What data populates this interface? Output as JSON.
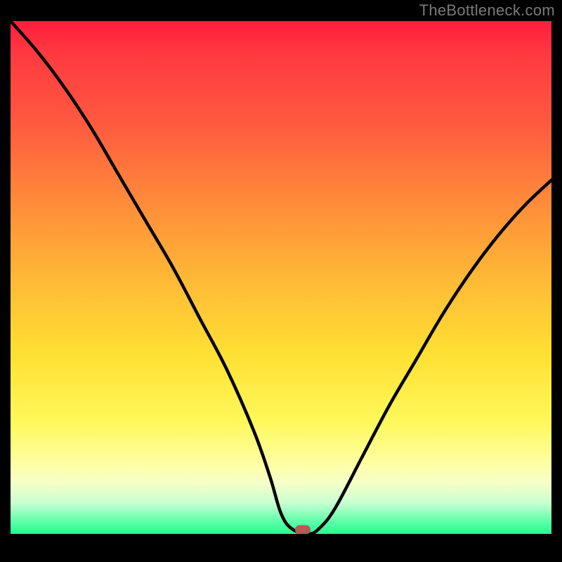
{
  "watermark": "TheBottleneck.com",
  "colors": {
    "gradient_top": "#ff1d3d",
    "gradient_mid": "#ffe033",
    "gradient_bottom": "#1fff8f",
    "curve": "#000000",
    "marker": "#b55a57",
    "background": "#000000"
  },
  "chart_data": {
    "type": "line",
    "title": "",
    "xlabel": "",
    "ylabel": "",
    "xlim": [
      0,
      100
    ],
    "ylim": [
      0,
      100
    ],
    "grid": false,
    "series": [
      {
        "name": "bottleneck-curve",
        "x": [
          0,
          5,
          10,
          15,
          20,
          25,
          30,
          35,
          40,
          45,
          48,
          50,
          52,
          55,
          57,
          60,
          65,
          70,
          75,
          80,
          85,
          90,
          95,
          100
        ],
        "y": [
          100,
          94,
          87,
          79,
          70,
          61,
          52,
          42,
          32,
          20,
          11,
          4,
          1,
          0,
          1,
          5,
          15,
          25,
          34,
          43,
          51,
          58,
          64,
          69
        ]
      }
    ],
    "marker": {
      "x": 54,
      "y": 0
    }
  }
}
